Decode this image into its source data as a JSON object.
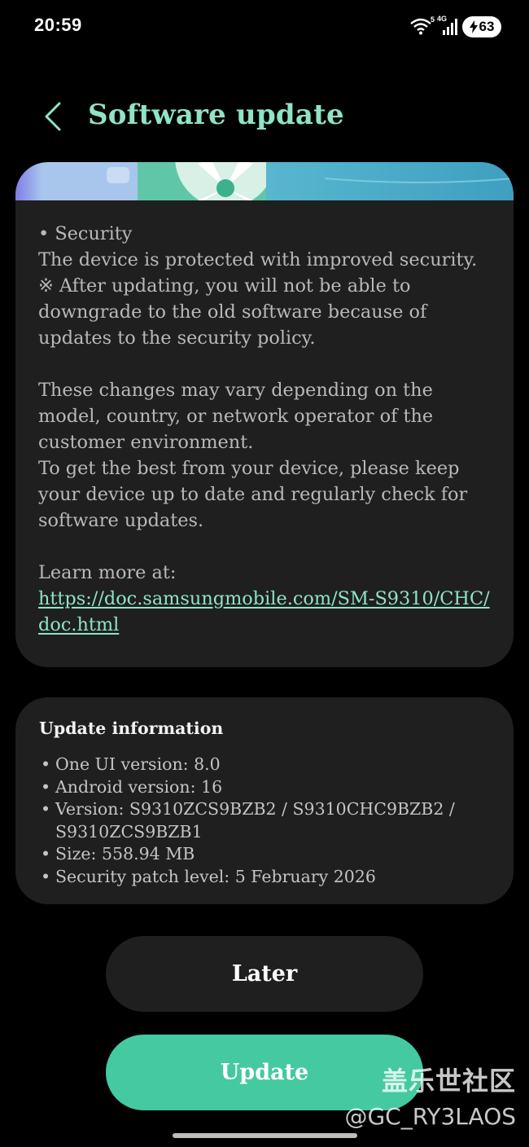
{
  "status_bar": {
    "time": "20:59",
    "network_label": "4G",
    "wifi_badge": "5",
    "battery_level": "63",
    "battery_charging": true
  },
  "header": {
    "title": "Software update",
    "back_icon": "chevron-left-icon"
  },
  "release_notes": {
    "security_heading": "• Security",
    "security_text": "The device is protected with improved security.\n※ After updating, you will not be able to downgrade to the old software because of updates to the security policy.",
    "disclaimer": "These changes may vary depending on the model, country, or network operator of the customer environment.\nTo get the best from your device, please keep your device up to date and regularly check for software updates.",
    "learn_more_label": "Learn more at:",
    "learn_more_url": "https://doc.samsungmobile.com/SM-S9310/CHC/doc.html"
  },
  "update_info": {
    "title": "Update information",
    "items": [
      "One UI version: 8.0",
      "Android version: 16",
      "Version: S9310ZCS9BZB2 / S9310CHC9BZB2 / S9310ZCS9BZB1",
      "Size: 558.94 MB",
      "Security patch level: 5 February 2026"
    ]
  },
  "buttons": {
    "later_label": "Later",
    "update_label": "Update"
  },
  "watermark": {
    "site": "盖乐世社区",
    "handle": "@GC_RY3LAOS"
  },
  "colors": {
    "accent": "#8fe3c7",
    "update_button": "#45c9a0",
    "card_bg": "#1f1f1f",
    "background": "#000000"
  }
}
